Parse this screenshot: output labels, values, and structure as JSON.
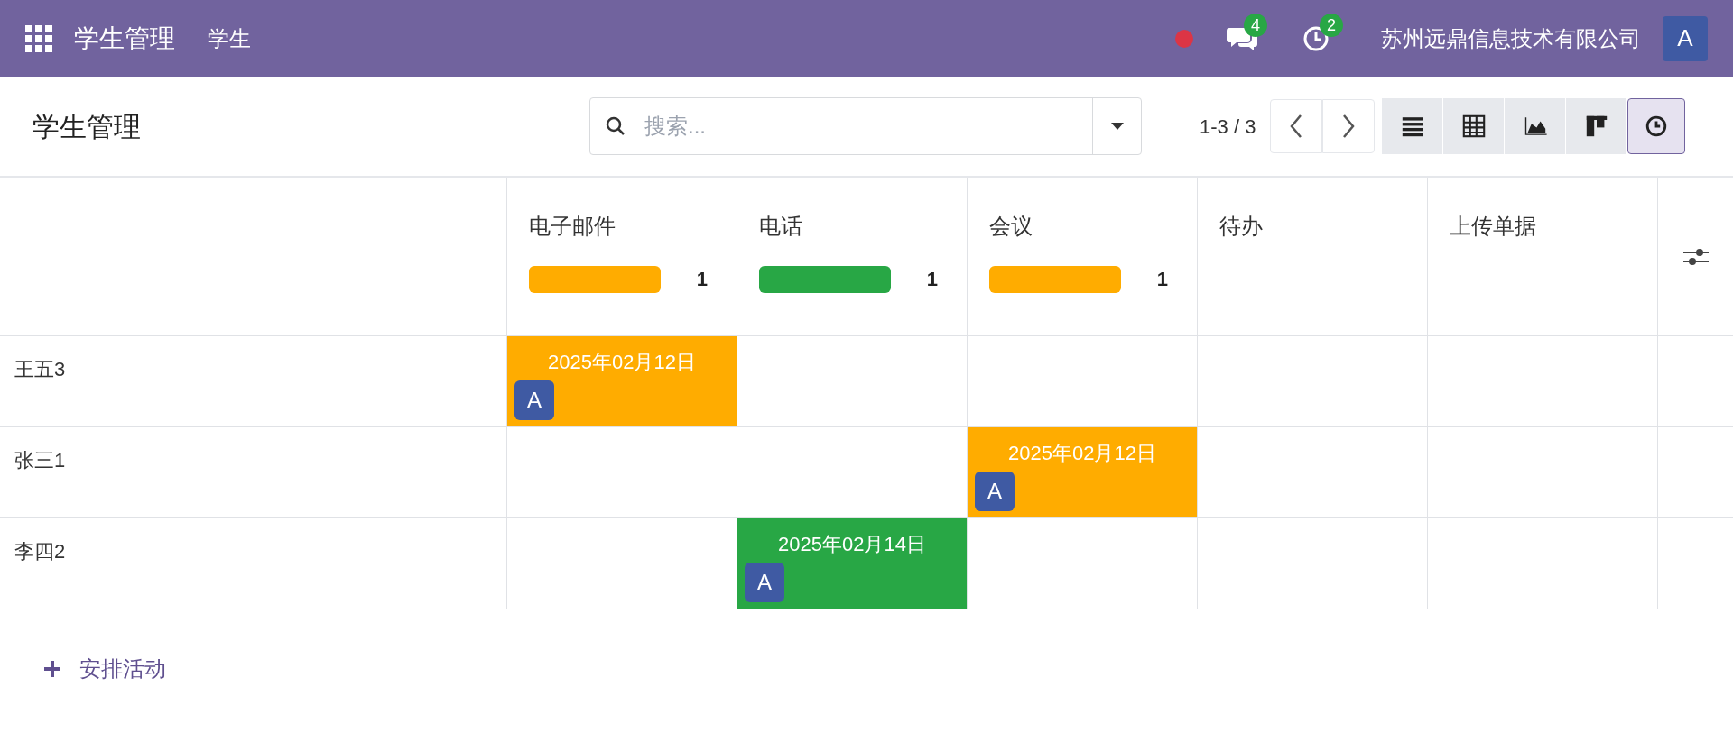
{
  "navbar": {
    "app_title": "学生管理",
    "menu": [
      "学生"
    ],
    "messages_badge": "4",
    "activities_badge": "2",
    "company": "苏州远鼎信息技术有限公司",
    "user_avatar": "A"
  },
  "control_panel": {
    "title": "学生管理",
    "search": {
      "placeholder": "搜索..."
    },
    "pager": "1-3 / 3",
    "views": [
      {
        "kind": "list",
        "selected": false
      },
      {
        "kind": "pivot",
        "selected": false
      },
      {
        "kind": "graph",
        "selected": false
      },
      {
        "kind": "kanban",
        "selected": false
      },
      {
        "kind": "activity",
        "selected": true
      }
    ]
  },
  "columns": [
    {
      "label": "电子邮件",
      "bar": {
        "color": "#ffac00",
        "count": "1"
      }
    },
    {
      "label": "电话",
      "bar": {
        "color": "#28a745",
        "count": "1"
      }
    },
    {
      "label": "会议",
      "bar": {
        "color": "#ffac00",
        "count": "1"
      }
    },
    {
      "label": "待办"
    },
    {
      "label": "上传单据"
    }
  ],
  "rows": [
    {
      "name": "王五3",
      "cells": [
        {
          "date": "2025年02月12日",
          "avatar": "A",
          "color": "#ffac00"
        },
        null,
        null,
        null,
        null
      ]
    },
    {
      "name": "张三1",
      "cells": [
        null,
        null,
        {
          "date": "2025年02月12日",
          "avatar": "A",
          "color": "#ffac00"
        },
        null,
        null
      ]
    },
    {
      "name": "李四2",
      "cells": [
        null,
        {
          "date": "2025年02月14日",
          "avatar": "A",
          "color": "#28a745"
        },
        null,
        null,
        null
      ]
    }
  ],
  "schedule_button": "安排活动"
}
